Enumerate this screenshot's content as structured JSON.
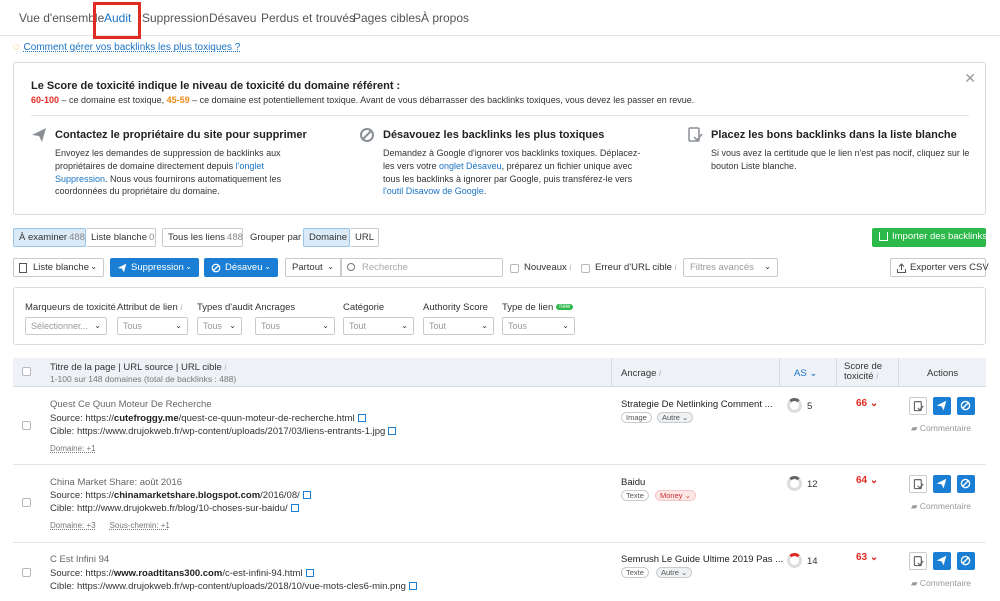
{
  "tabs": [
    {
      "label": "Vue d'ensemble"
    },
    {
      "label": "Audit"
    },
    {
      "label": "Suppression"
    },
    {
      "label": "Désaveu"
    },
    {
      "label": "Perdus et trouvés"
    },
    {
      "label": "Pages cibles"
    },
    {
      "label": "À propos"
    }
  ],
  "help_link": "Comment gérer vos backlinks les plus toxiques ?",
  "info": {
    "title": "Le Score de toxicité indique le niveau de toxicité du domaine référent :",
    "range_red": "60-100",
    "range_red_desc": " – ce domaine est toxique, ",
    "range_orange": "45-59",
    "range_orange_desc": " – ce domaine est potentiellement toxique. Avant de vous débarrasser des backlinks toxiques, vous devez les passer en revue.",
    "columns": [
      {
        "icon": "paper-plane-icon",
        "heading": "Contactez le propriétaire du site pour supprimer",
        "text_before": "Envoyez les demandes de suppression de backlinks aux propriétaires de domaine directement depuis ",
        "link": "l'onglet Suppression",
        "text_after": ". Nous vous fournirons automatiquement les coordonnées du propriétaire du domaine."
      },
      {
        "icon": "prohibited-icon",
        "heading": "Désavouez les backlinks les plus toxiques",
        "text_before": "Demandez à Google d'ignorer vos backlinks toxiques. Déplacez-les vers votre ",
        "link": "onglet Désaveu",
        "text_middle": ", préparez un fichier unique avec tous les backlinks à ignorer par Google, puis transférez-le vers ",
        "link2": "l'outil Disavow de Google",
        "text_after": "."
      },
      {
        "icon": "whitelist-icon",
        "heading": "Placez les bons backlinks dans la liste blanche",
        "text_before": "Si vous avez la certitude que le lien n'est pas nocif, cliquez sur le bouton Liste blanche."
      }
    ]
  },
  "filter_tabs": [
    {
      "label": "À examiner",
      "count": "488"
    },
    {
      "label": "Liste blanche",
      "count": "0"
    },
    {
      "label": "Tous les liens",
      "count": "488"
    }
  ],
  "group_label": "Grouper par",
  "group_options": [
    "Domaine",
    "URL"
  ],
  "import_button": "Importer des backlinks",
  "toolbar": {
    "whitelist": "Liste blanche",
    "suppression": "Suppression",
    "desaveu": "Désaveu",
    "partout": "Partout",
    "search_placeholder": "Recherche",
    "nouveaux": "Nouveaux",
    "erreur": "Erreur d'URL cible",
    "advanced": "Filtres avancés",
    "export": "Exporter vers CSV"
  },
  "advanced_filters": [
    {
      "label": "Marqueurs de toxicité",
      "value": "Sélectionner..."
    },
    {
      "label": "Attribut de lien",
      "value": "Tous"
    },
    {
      "label": "Types d'audit",
      "value": "Tous"
    },
    {
      "label": "Ancrages",
      "value": "Tous"
    },
    {
      "label": "Catégorie",
      "value": "Tout"
    },
    {
      "label": "Authority Score",
      "value": "Tout"
    },
    {
      "label": "Type de lien",
      "value": "Tous",
      "badge": "new"
    }
  ],
  "table": {
    "col_title": "Titre de la page | URL source | URL cible",
    "col_sub": "1-100 sur 148 domaines (total de backlinks : 488)",
    "col_anchor": "Ancrage",
    "col_as": "AS",
    "col_score": "Score de toxicité",
    "col_actions": "Actions",
    "source_label": "Source: ",
    "target_label": "Cible: ",
    "comment_label": "Commentaire",
    "rows": [
      {
        "title": "Quest Ce Quun Moteur De Recherche",
        "source_prefix": "https://",
        "source_domain": "cutefroggy.me",
        "source_path": "/quest-ce-quun-moteur-de-recherche.html",
        "target": "https://www.drujokweb.fr/wp-content/uploads/2017/03/liens-entrants-1.jpg",
        "meta": [
          "Domaine: +1"
        ],
        "anchor": "Strategie De Netlinking Comment ...",
        "tags": [
          "Image",
          "Autre ⌄"
        ],
        "as": "5",
        "score": "66"
      },
      {
        "title": "China Market Share: août 2016",
        "source_prefix": "https://",
        "source_domain": "chinamarketshare.blogspot.com",
        "source_path": "/2016/08/",
        "target": "http://www.drujokweb.fr/blog/10-choses-sur-baidu/",
        "meta": [
          "Domaine: +3",
          "Sous-chemin: +1"
        ],
        "anchor": "Baidu",
        "tags": [
          "Texte",
          "Money ⌄"
        ],
        "as": "12",
        "score": "64"
      },
      {
        "title": "C Est Infini 94",
        "source_prefix": "https://",
        "source_domain": "www.roadtitans300.com",
        "source_path": "/c-est-infini-94.html",
        "target": "https://www.drujokweb.fr/wp-content/uploads/2018/10/vue-mots-cles6-min.png",
        "meta": [],
        "anchor": "Semrush Le Guide Ultime 2019 Pas ...",
        "tags": [
          "Texte",
          "Autre ⌄"
        ],
        "as": "14",
        "score": "63"
      }
    ]
  }
}
